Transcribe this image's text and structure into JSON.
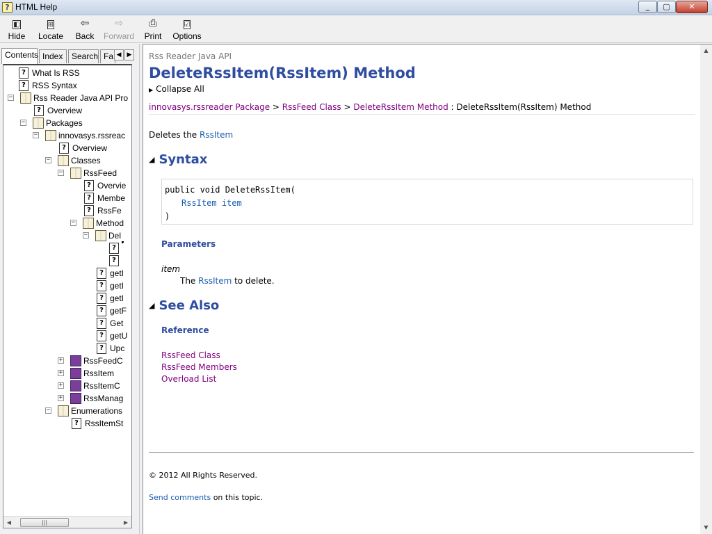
{
  "window": {
    "title": "HTML Help"
  },
  "toolbar": {
    "hide": "Hide",
    "locate": "Locate",
    "back": "Back",
    "forward": "Forward",
    "print": "Print",
    "options": "Options"
  },
  "tabs": [
    "Contents",
    "Index",
    "Search",
    "Fa"
  ],
  "tree": [
    {
      "label": "What Is RSS"
    },
    {
      "label": "RSS Syntax"
    },
    {
      "label": "Rss Reader Java API Pro"
    },
    {
      "label": "Overview"
    },
    {
      "label": "Packages"
    },
    {
      "label": "innovasys.rssreac"
    },
    {
      "label": "Overview"
    },
    {
      "label": "Classes"
    },
    {
      "label": "RssFeed"
    },
    {
      "label": "Overvie"
    },
    {
      "label": "Membe"
    },
    {
      "label": "RssFe"
    },
    {
      "label": "Method"
    },
    {
      "label": "Del"
    },
    {
      "label": ""
    },
    {
      "label": ""
    },
    {
      "label": "getI"
    },
    {
      "label": "getI"
    },
    {
      "label": "getI"
    },
    {
      "label": "getF"
    },
    {
      "label": "Get"
    },
    {
      "label": "getU"
    },
    {
      "label": "Upc"
    },
    {
      "label": "RssFeedC"
    },
    {
      "label": "RssItem"
    },
    {
      "label": "RssItemC"
    },
    {
      "label": "RssManag"
    },
    {
      "label": "Enumerations"
    },
    {
      "label": "RssItemSt"
    }
  ],
  "topic": {
    "header": "Rss Reader Java API",
    "title": "DeleteRssItem(RssItem) Method",
    "collapse_all": "Collapse All",
    "breadcrumb": {
      "package": "innovasys.rssreader Package",
      "sep1": " > ",
      "class": "RssFeed Class",
      "sep2": " > ",
      "method_group": "DeleteRssItem Method",
      "sep3": " : ",
      "current": "DeleteRssItem(RssItem) Method"
    },
    "summary_text": "Deletes the ",
    "summary_link": "RssItem",
    "syntax_heading": "Syntax",
    "code": {
      "line1": "public void DeleteRssItem(",
      "line2_type": "RssItem",
      "line2_param": "item",
      "line3": ")"
    },
    "parameters_heading": "Parameters",
    "param_name": "item",
    "param_desc_pre": "The ",
    "param_desc_link": "RssItem",
    "param_desc_post": " to delete.",
    "see_also_heading": "See Also",
    "reference_heading": "Reference",
    "reference_links": [
      "RssFeed Class",
      "RssFeed Members",
      "Overload List"
    ],
    "copyright": "© 2012 All Rights Reserved.",
    "feedback_link": "Send comments",
    "feedback_text": " on this topic."
  }
}
